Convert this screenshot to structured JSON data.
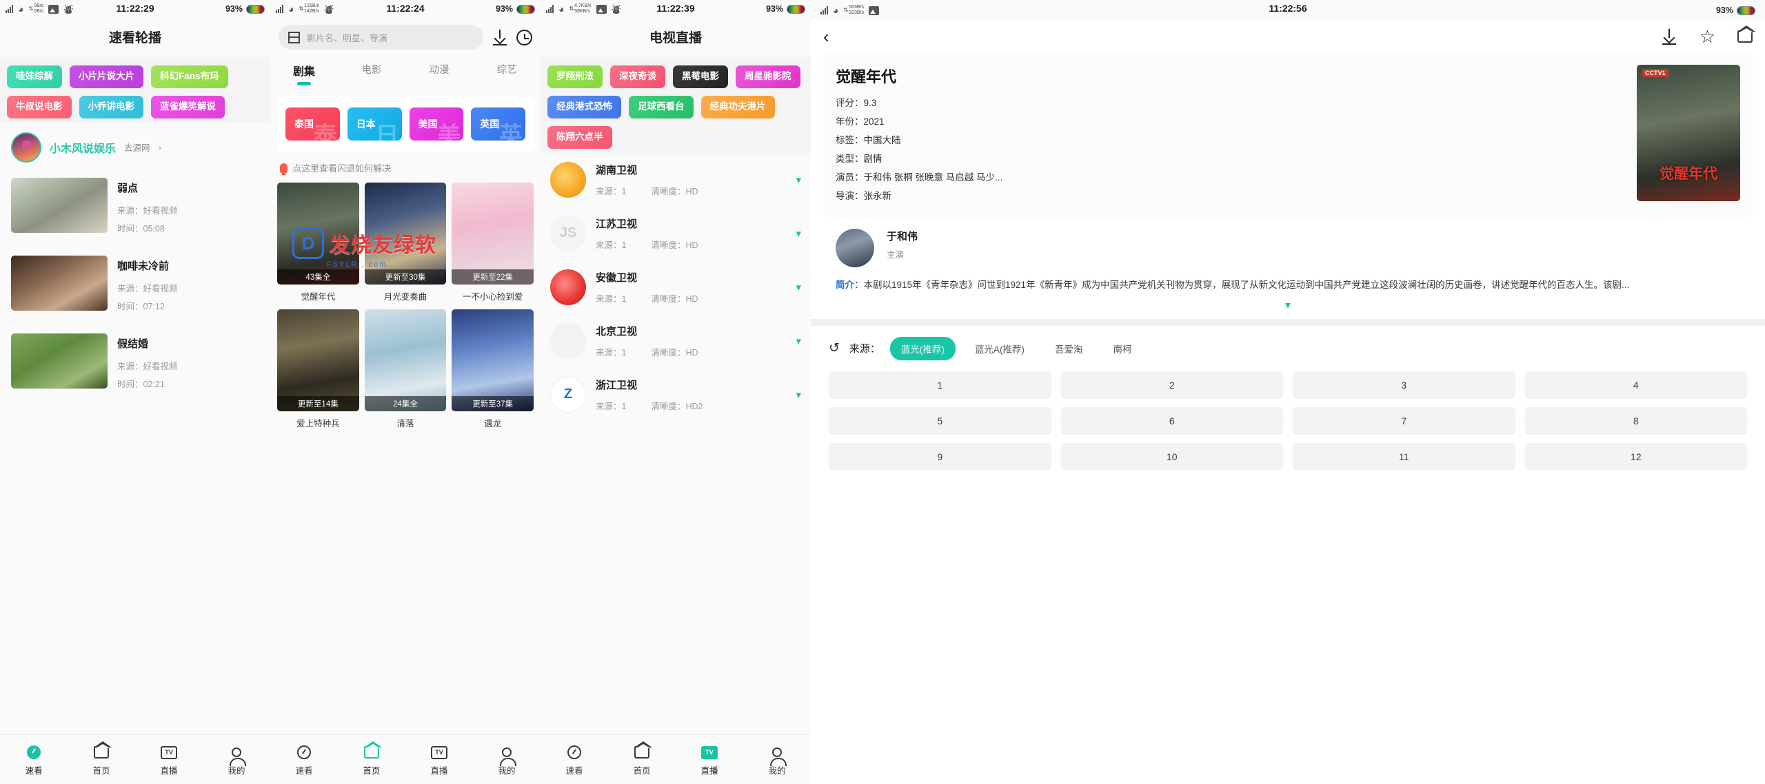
{
  "panels": {
    "p1": {
      "status": {
        "speed_up": "0B/s",
        "speed_down": "0B/s",
        "time": "11:22:29",
        "battery": "93%"
      },
      "title": "速看轮播",
      "tags": [
        {
          "label": "哇妹综解",
          "color": "#3fd9b4"
        },
        {
          "label": "小片片说大片",
          "color": "#c34ce0"
        },
        {
          "label": "科幻Fans布玛",
          "color": "#9ade4e"
        },
        {
          "label": "牛叔说电影",
          "color": "#fb6a7e"
        },
        {
          "label": "小乔讲电影",
          "color": "#3fc4dd"
        },
        {
          "label": "蓝雀爆笑解说",
          "color": "#e84ce0"
        }
      ],
      "channel": {
        "name": "小木风说娱乐",
        "link": "去源网",
        "arrow": "›"
      },
      "videos": [
        {
          "title": "弱点",
          "source_label": "来源：",
          "source": "好看视频",
          "time_label": "时间：",
          "time": "05:08"
        },
        {
          "title": "咖啡未冷前",
          "source_label": "来源：",
          "source": "好看视频",
          "time_label": "时间：",
          "time": "07:12"
        },
        {
          "title": "假结婚",
          "source_label": "来源：",
          "source": "好看视频",
          "time_label": "时间：",
          "time": "02:21"
        }
      ],
      "nav": [
        {
          "label": "速看",
          "icon": "speed-icon",
          "active": true
        },
        {
          "label": "首页",
          "icon": "home-icon",
          "active": false
        },
        {
          "label": "直播",
          "icon": "tv-icon",
          "active": false
        },
        {
          "label": "我的",
          "icon": "user-icon",
          "active": false
        }
      ]
    },
    "p2": {
      "status": {
        "speed_up": "131B/s",
        "speed_down": "142B/s",
        "time": "11:22:24",
        "battery": "93%"
      },
      "search": {
        "placeholder": "影片名、明星、导演",
        "scan_icon": "scan-icon",
        "download_icon": "download-icon",
        "history_icon": "history-icon"
      },
      "tabs": [
        {
          "label": "剧集",
          "active": true
        },
        {
          "label": "电影",
          "active": false
        },
        {
          "label": "动漫",
          "active": false
        },
        {
          "label": "综艺",
          "active": false
        }
      ],
      "countries": [
        {
          "label": "泰国",
          "ghost": "泰",
          "color": "#f9475e"
        },
        {
          "label": "日本",
          "ghost": "日",
          "color": "#1bb8ea"
        },
        {
          "label": "美国",
          "ghost": "美",
          "color": "#e535e0"
        },
        {
          "label": "英国",
          "ghost": "英",
          "color": "#3d7ef0"
        }
      ],
      "tip": "点这里查看闪退如何解决",
      "grid": [
        {
          "title": "觉醒年代",
          "badge": "43集全",
          "poster": "ps1"
        },
        {
          "title": "月光变奏曲",
          "badge": "更新至30集",
          "poster": "ps2"
        },
        {
          "title": "一不小心捡到爱",
          "badge": "更新至22集",
          "poster": "ps3"
        },
        {
          "title": "爱上特种兵",
          "badge": "更新至14集",
          "poster": "ps4"
        },
        {
          "title": "清落",
          "badge": "24集全",
          "poster": "ps5"
        },
        {
          "title": "遇龙",
          "badge": "更新至37集",
          "poster": "ps6"
        }
      ],
      "watermark": {
        "logo": "D",
        "text": "发烧友绿软",
        "sub": "FSYLR . com"
      },
      "nav": [
        {
          "label": "速看",
          "icon": "speed-icon",
          "active": false
        },
        {
          "label": "首页",
          "icon": "home-icon",
          "active": true
        },
        {
          "label": "直播",
          "icon": "tv-icon",
          "active": false
        },
        {
          "label": "我的",
          "icon": "user-icon",
          "active": false
        }
      ]
    },
    "p3": {
      "status": {
        "speed_up": "4.7KB/s",
        "speed_down": "58KB/s",
        "time": "11:22:39",
        "battery": "93%"
      },
      "title": "电视直播",
      "tags": [
        {
          "label": "罗翔刑法",
          "color": "#8fd94a"
        },
        {
          "label": "深夜奇谈",
          "color": "#f4647e"
        },
        {
          "label": "黑莓电影",
          "color": "#2f2f2f"
        },
        {
          "label": "周星驰影院",
          "color": "#e54ccd"
        },
        {
          "label": "经典港式恐怖",
          "color": "#4a82ea"
        },
        {
          "label": "足球西看台",
          "color": "#2fc46e"
        },
        {
          "label": "经典功夫港片",
          "color": "#f7a23b"
        },
        {
          "label": "陈翔六点半",
          "color": "#f5637a"
        }
      ],
      "channels": [
        {
          "name": "湖南卫视",
          "source_label": "来源：",
          "source": "1",
          "quality_label": "清晰度：",
          "quality": "HD",
          "logo": "hn"
        },
        {
          "name": "江苏卫视",
          "source_label": "来源：",
          "source": "1",
          "quality_label": "清晰度：",
          "quality": "HD",
          "logo": "js"
        },
        {
          "name": "安徽卫视",
          "source_label": "来源：",
          "source": "1",
          "quality_label": "清晰度：",
          "quality": "HD",
          "logo": "ah"
        },
        {
          "name": "北京卫视",
          "source_label": "来源：",
          "source": "1",
          "quality_label": "清晰度：",
          "quality": "HD",
          "logo": "bj"
        },
        {
          "name": "浙江卫视",
          "source_label": "来源：",
          "source": "1",
          "quality_label": "清晰度：",
          "quality": "HD2",
          "logo": "zj"
        }
      ],
      "nav": [
        {
          "label": "速看",
          "icon": "speed-icon",
          "active": false
        },
        {
          "label": "首页",
          "icon": "home-icon",
          "active": false
        },
        {
          "label": "直播",
          "icon": "tv-icon",
          "active": true
        },
        {
          "label": "我的",
          "icon": "user-icon",
          "active": false
        }
      ]
    },
    "p4": {
      "status": {
        "speed_up": "503B/s",
        "speed_down": "923B/s",
        "time": "11:22:56",
        "battery": "93%"
      },
      "toolbar": {
        "back_icon": "back-arrow-icon",
        "download_icon": "download-icon",
        "star_icon": "star-icon",
        "home_icon": "home-icon"
      },
      "detail": {
        "title": "觉醒年代",
        "lines": [
          {
            "label": "评分：",
            "value": "9.3"
          },
          {
            "label": "年份：",
            "value": "2021"
          },
          {
            "label": "标签：",
            "value": "中国大陆"
          },
          {
            "label": "类型：",
            "value": "剧情"
          },
          {
            "label": "演员：",
            "value": "于和伟 张桐 张晚意 马启越 马少..."
          },
          {
            "label": "导演：",
            "value": "张永新"
          }
        ],
        "poster_title": "觉醒年代",
        "poster_tag": "CCTV1"
      },
      "actor": {
        "name": "于和伟",
        "role": "主演"
      },
      "summary_label": "简介：",
      "summary": "本剧以1915年《青年杂志》问世到1921年《新青年》成为中国共产党机关刊物为贯穿，展现了从新文化运动到中国共产党建立这段波澜壮阔的历史画卷，讲述觉醒年代的百态人生。该剧...",
      "expand_icon": "chevron-down-icon",
      "sources": {
        "refresh_icon": "refresh-icon",
        "label": "来源：",
        "chips": [
          {
            "label": "蓝光(推荐)",
            "active": true
          },
          {
            "label": "蓝光A(推荐)",
            "active": false
          },
          {
            "label": "吾爱淘",
            "active": false
          },
          {
            "label": "南柯",
            "active": false
          }
        ]
      },
      "episodes": [
        "1",
        "2",
        "3",
        "4",
        "5",
        "6",
        "7",
        "8",
        "9",
        "10",
        "11",
        "12"
      ]
    }
  }
}
